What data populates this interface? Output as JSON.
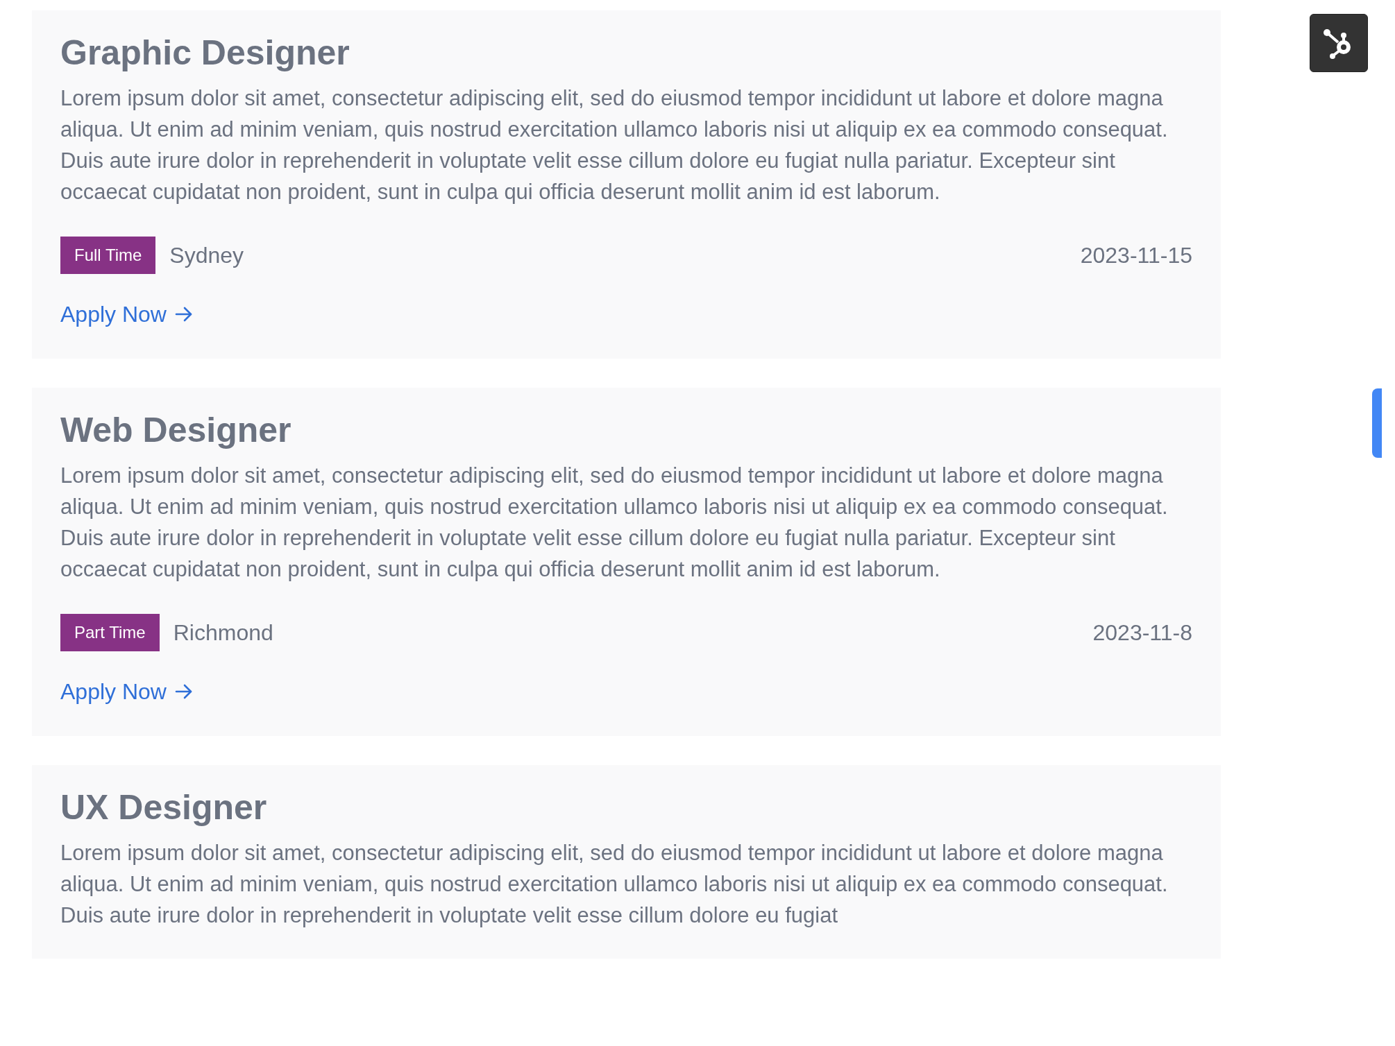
{
  "jobs": [
    {
      "title": "Graphic Designer",
      "description": "Lorem ipsum dolor sit amet, consectetur adipiscing elit, sed do eiusmod tempor incididunt ut labore et dolore magna aliqua. Ut enim ad minim veniam, quis nostrud exercitation ullamco laboris nisi ut aliquip ex ea commodo consequat. Duis aute irure dolor in reprehenderit in voluptate velit esse cillum dolore eu fugiat nulla pariatur. Excepteur sint occaecat cupidatat non proident, sunt in culpa qui officia deserunt mollit anim id est laborum.",
      "type": "Full Time",
      "location": "Sydney",
      "date": "2023-11-15",
      "link": "Apply Now"
    },
    {
      "title": "Web Designer",
      "description": "Lorem ipsum dolor sit amet, consectetur adipiscing elit, sed do eiusmod tempor incididunt ut labore et dolore magna aliqua. Ut enim ad minim veniam, quis nostrud exercitation ullamco laboris nisi ut aliquip ex ea commodo consequat. Duis aute irure dolor in reprehenderit in voluptate velit esse cillum dolore eu fugiat nulla pariatur. Excepteur sint occaecat cupidatat non proident, sunt in culpa qui officia deserunt mollit anim id est laborum.",
      "type": "Part Time",
      "location": "Richmond",
      "date": "2023-11-8",
      "link": "Apply Now"
    },
    {
      "title": "UX Designer",
      "description": "Lorem ipsum dolor sit amet, consectetur adipiscing elit, sed do eiusmod tempor incididunt ut labore et dolore magna aliqua. Ut enim ad minim veniam, quis nostrud exercitation ullamco laboris nisi ut aliquip ex ea commodo consequat. Duis aute irure dolor in reprehenderit in voluptate velit esse cillum dolore eu fugiat"
    }
  ]
}
